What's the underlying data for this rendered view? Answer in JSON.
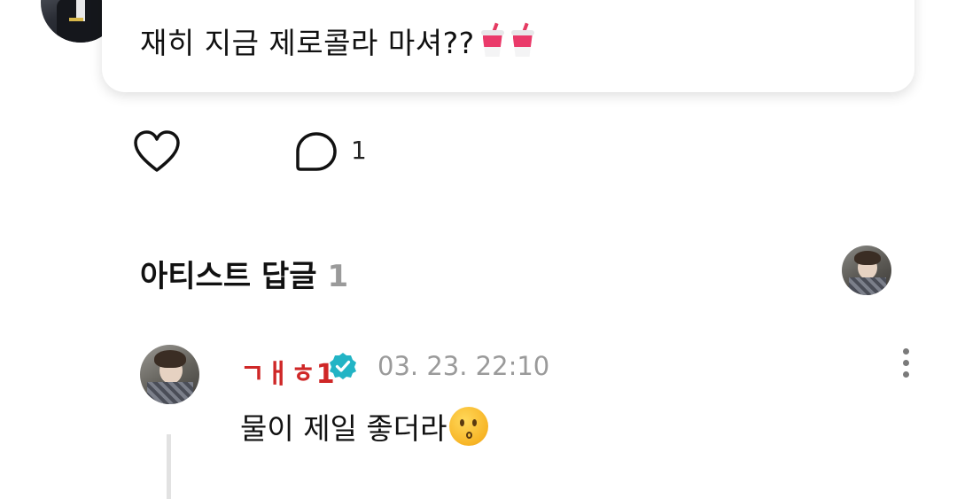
{
  "post": {
    "avatar_alt": "author-avatar",
    "bubble_text": "재히 지금 제로콜라 마셔??",
    "bubble_emojis": [
      "cup-with-straw-icon",
      "cup-with-straw-icon"
    ]
  },
  "actions": {
    "like_icon": "heart-icon",
    "comment_icon": "comment-icon",
    "comment_count": "1"
  },
  "section": {
    "title": "아티스트 답글",
    "count": "1"
  },
  "reply": {
    "name": "ㄱㅐㅎ1",
    "name_color": "#cf2727",
    "verified_icon": "verified-badge-icon",
    "verified_color": "#22b4c5",
    "time": "03. 23. 22:10",
    "text": "물이 제일 좋더라",
    "emoji": "kissing-face-icon"
  }
}
